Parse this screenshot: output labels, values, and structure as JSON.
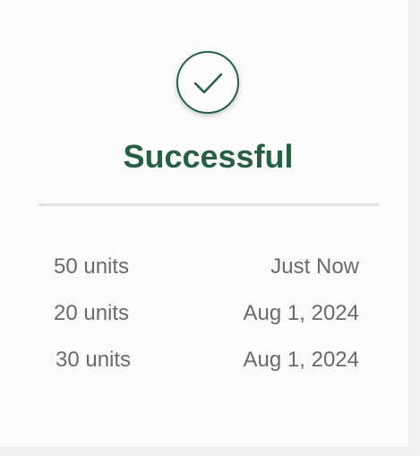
{
  "status": {
    "icon": "check-icon",
    "title": "Successful",
    "accent_color": "#256046"
  },
  "transactions": [
    {
      "amount": "50 units",
      "time": "Just Now"
    },
    {
      "amount": "20 units",
      "time": "Aug 1, 2024"
    },
    {
      "amount": "30 units",
      "time": "Aug 1, 2024"
    }
  ]
}
